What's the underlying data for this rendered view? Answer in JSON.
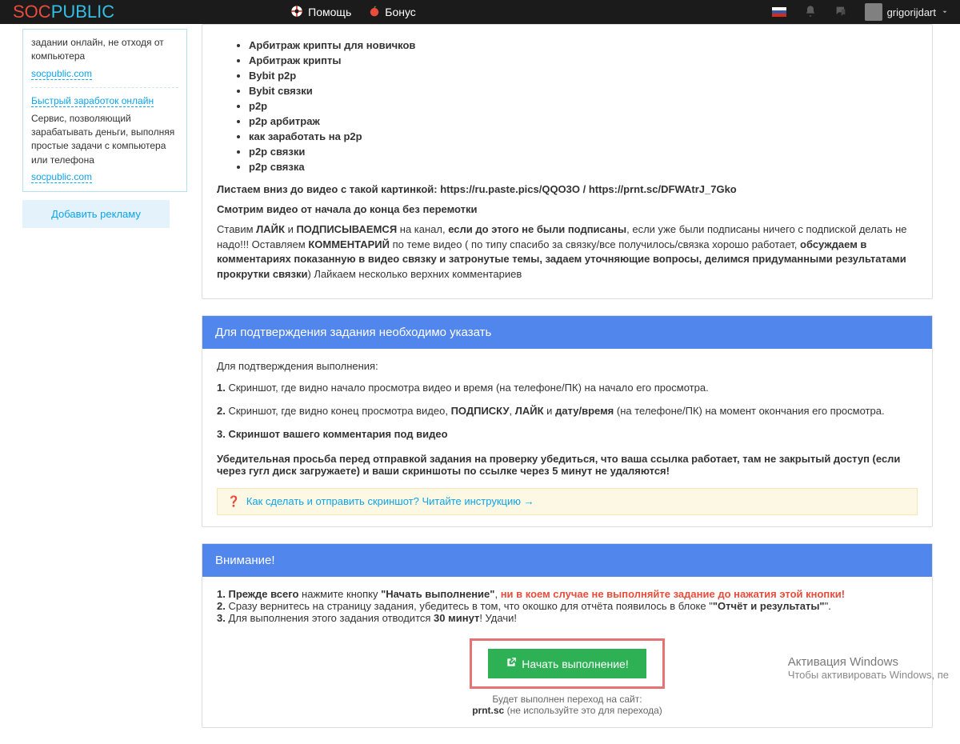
{
  "topbar": {
    "help": "Помощь",
    "bonus": "Бонус",
    "username": "grigorijdart"
  },
  "sidebar": {
    "promo1_tail": "задании онлайн, не отходя от компьютера",
    "promo1_link": "socpublic.com",
    "promo2_title": "Быстрый заработок онлайн",
    "promo2_body": "Сервис, позволяющий зарабатывать деньги, выполняя простые задачи с компьютера или телефона",
    "promo2_link": "socpublic.com",
    "add_ad": "Добавить рекламу"
  },
  "task": {
    "bullets": [
      "Арбитраж крипты для новичков",
      "Арбитраж крипты",
      "Bybit p2p",
      "Bybit связки",
      "p2p",
      "p2p арбитраж",
      "как заработать на p2p",
      "p2p связки",
      "p2p связка"
    ],
    "scroll_line": "Листаем вниз до видео с такой картинкой: https://ru.paste.pics/QQO3O / https://prnt.sc/DFWAtrJ_7Gko",
    "watch_line": "Смотрим видео от начала до конца без перемотки",
    "like_pref": "Ставим ",
    "like_b": "ЛАЙК",
    "and": " и ",
    "sub_b": "ПОДПИСЫВАЕМСЯ",
    "like_mid": " на канал, ",
    "if_b": "если до этого не были подписаны",
    "like_tail": ", если уже были подписаны ничего с подпиской делать не надо!!! Оставляем ",
    "com_b": "КОММЕНТАРИЙ",
    "com_mid": " по теме видео ( по типу спасибо за связку/все получилось/связка хорошо работает, ",
    "com_b2": "обсуждаем в комментариях показанную в видео связку и затронутые темы, задаем уточняющие вопросы, делимся придуманными результатами прокрутки связки",
    "com_tail": ") Лайкаем несколько верхних комментариев"
  },
  "confirm": {
    "header": "Для подтверждения задания необходимо указать",
    "intro": "Для подтверждения выполнения:",
    "i1": "Скриншот, где видно начало просмотра видео и время (на телефоне/ПК) на начало его просмотра.",
    "i2a": "Скриншот, где видно конец просмотра видео, ",
    "i2b1": "ПОДПИСКУ",
    "i2b2": "ЛАЙК",
    "i2c": "дату/время",
    "i2d": " (на телефоне/ПК) на момент окончания его просмотра.",
    "i3": "Скриншот вашего комментария под видео",
    "warn": "Убедительная просьба перед отправкой задания на проверку убедиться, что ваша ссылка работает, там не закрытый доступ (если через гугл диск загружаете) и ваши скриншоты по ссылке через 5 минут не удаляются!",
    "help_q": "Как сделать и отправить скриншот? ",
    "help_link": "Читайте инструкцию"
  },
  "attn": {
    "header": "Внимание!",
    "l1a": "Прежде всего",
    "l1b": " нажмите кнопку ",
    "l1c": "\"Начать выполнение\"",
    "l1d": "ни в коем случае не выполняйте задание до нажатия этой кнопки!",
    "l2a": "Сразу вернитесь на страницу задания, убедитесь в том, что окошко для отчёта появилось в блоке ",
    "l2b": "\"Отчёт и результаты\"",
    "l3a": "Для выполнения этого задания отводится ",
    "l3b": "30 минут",
    "l3c": "! Удачи!",
    "btn": "Начать выполнение!",
    "hint1": "Будет выполнен переход на сайт:",
    "hint2": "prnt.sc",
    "hint3": " (не используйте это для перехода)"
  },
  "win": {
    "t": "Активация Windows",
    "s": "Чтобы активировать Windows, пе"
  }
}
